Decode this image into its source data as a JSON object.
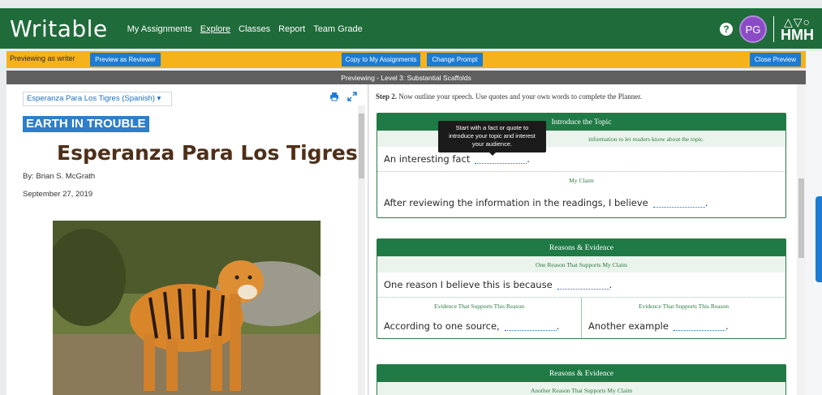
{
  "app": {
    "logo": "Writable",
    "nav": [
      "My Assignments",
      "Explore",
      "Classes",
      "Report",
      "Team Grade"
    ],
    "nav_active": "Explore",
    "help_icon": "?",
    "avatar_initials": "PG",
    "brand_shapes": "△▽○",
    "brand_text": "HMH"
  },
  "preview_bar": {
    "label": "Previewing as writer",
    "preview_reviewer": "Preview as Reviewer",
    "copy": "Copy to My Assignments",
    "change_prompt": "Change Prompt",
    "close_preview": "Close Preview"
  },
  "scaffold_bar": "Previewing - Level 3: Substantial Scaffolds",
  "document": {
    "select_value": "Esperanza Para Los Tigres (Spanish)",
    "band": "EARTH IN TROUBLE",
    "title": "Esperanza Para Los Tigres",
    "author": "By: Brian S. McGrath",
    "date": "September 27, 2019"
  },
  "planner": {
    "step_bold": "Step 2.",
    "step_text": " Now outline your speech. Use quotes and your own words to complete the Planner.",
    "tooltip": [
      "Start with a fact or quote to",
      "introduce your topic and interest",
      "your audience."
    ],
    "card1": {
      "title": "Introduce the Topic",
      "sub": "information to let readers know about the topic.",
      "s1": "An interesting fact",
      "claim_head": "My Claim",
      "s2": "After reviewing the information in the readings, I believe"
    },
    "card2": {
      "title": "Reasons & Evidence",
      "sub": "One Reason That Supports My Claim",
      "s1": "One reason I believe this is because",
      "ev_left_head": "Evidence That Supports This Reason",
      "ev_right_head": "Evidence That Supports This Reason",
      "ev_left": "According to one source,",
      "ev_right": "Another example"
    },
    "card3": {
      "title": "Reasons & Evidence",
      "sub": "Another Reason That Supports My Claim"
    },
    "period": "."
  },
  "colors": {
    "header_green": "#1f6b3a",
    "preview_yellow": "#f6b21b",
    "button_blue": "#1c7bd3",
    "card_green": "#1f7a45",
    "avatar_purple": "#8b4bc6"
  },
  "icons": {
    "print": "printer-icon",
    "expand": "expand-icon",
    "dropdown": "chevron-down-icon"
  }
}
